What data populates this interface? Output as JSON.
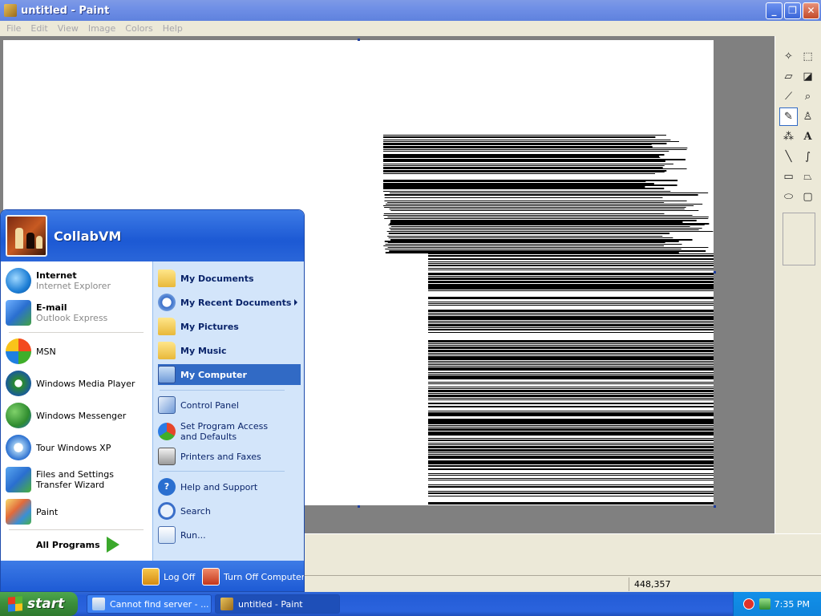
{
  "window": {
    "title": "untitled - Paint",
    "minimize": "_",
    "maximize": "❐",
    "close": "✕"
  },
  "menubar": [
    "File",
    "Edit",
    "View",
    "Image",
    "Colors",
    "Help"
  ],
  "status": {
    "coords": "448,357"
  },
  "start_menu": {
    "username": "CollabVM",
    "pinned": [
      {
        "title": "Internet",
        "subtitle": "Internet Explorer"
      },
      {
        "title": "E-mail",
        "subtitle": "Outlook Express"
      }
    ],
    "recent": [
      "MSN",
      "Windows Media Player",
      "Windows Messenger",
      "Tour Windows XP",
      "Files and Settings Transfer Wizard",
      "Paint"
    ],
    "all_programs": "All Programs",
    "right": {
      "my_documents": "My Documents",
      "my_recent_documents": "My Recent Documents",
      "my_pictures": "My Pictures",
      "my_music": "My Music",
      "my_computer": "My Computer",
      "control_panel": "Control Panel",
      "set_program_access": "Set Program Access and Defaults",
      "printers_and_faxes": "Printers and Faxes",
      "help_and_support": "Help and Support",
      "search": "Search",
      "run": "Run..."
    },
    "footer": {
      "log_off": "Log Off",
      "turn_off": "Turn Off Computer"
    }
  },
  "taskbar": {
    "start": "start",
    "tasks": [
      "Cannot find server - ...",
      "untitled - Paint"
    ],
    "clock": "7:35 PM"
  },
  "colors": {
    "highlight": "#316ac5",
    "taskbar": "#245dd7",
    "start_green": "#3a8d3a"
  }
}
